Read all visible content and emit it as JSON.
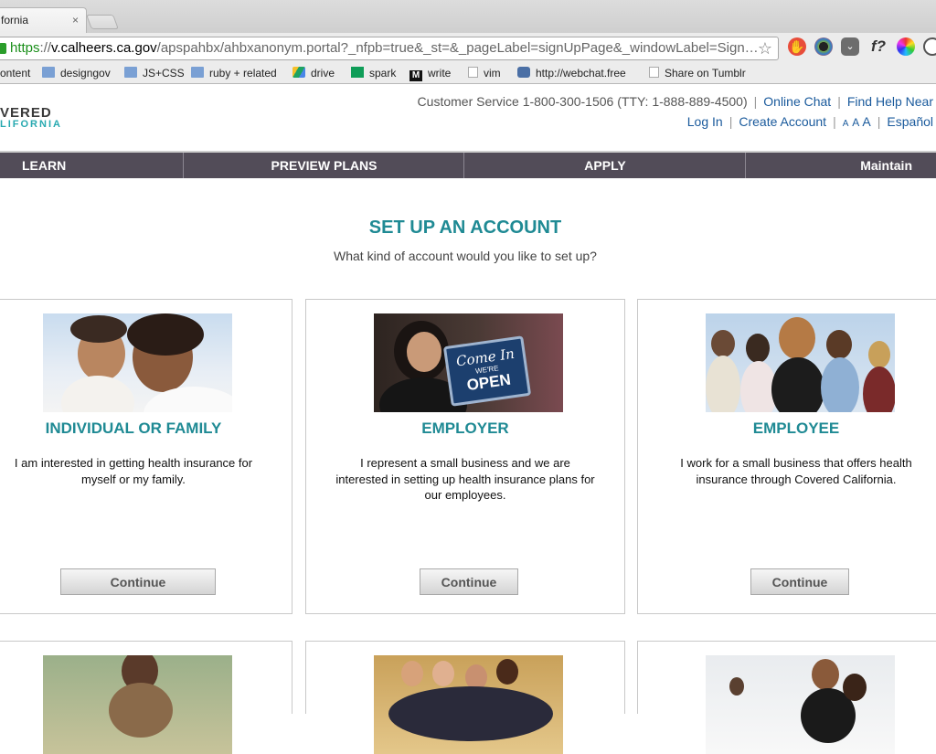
{
  "browser": {
    "tab_title": "fornia",
    "tab_close": "×",
    "url_scheme": "https",
    "url_sep": "://",
    "url_host": "v.calheers.ca.gov",
    "url_rest": "/apspahbx/ahbxanonym.portal?_nfpb=true&_st=&_pageLabel=signUpPage&_windowLabel=Sign…",
    "star_icon": "☆",
    "extensions": [
      "stop-hand-icon",
      "color-wheel-icon",
      "pocket-icon",
      "font-icon",
      "color-picker-icon",
      "extension-icon"
    ],
    "ext_labels": {
      "font": "f?"
    }
  },
  "bookmarks": [
    {
      "label": "ontent",
      "icon": "page-icon"
    },
    {
      "label": "designgov",
      "icon": "folder-icon"
    },
    {
      "label": "JS+CSS",
      "icon": "folder-icon"
    },
    {
      "label": "ruby + related",
      "icon": "folder-icon"
    },
    {
      "label": "drive",
      "icon": "drive-icon"
    },
    {
      "label": "spark",
      "icon": "sheets-icon"
    },
    {
      "label": "write",
      "icon": "medium-icon"
    },
    {
      "label": "vim",
      "icon": "page-icon"
    },
    {
      "label": "http://webchat.free",
      "icon": "globe-icon"
    },
    {
      "label": "Share on Tumblr",
      "icon": "page-icon"
    }
  ],
  "header": {
    "logo_top": "VERED",
    "logo_bottom": "LIFORNIA",
    "customer_service": "Customer Service 1-800-300-1506 (TTY: 1-888-889-4500)",
    "online_chat": "Online Chat",
    "find_help": "Find Help Near",
    "log_in": "Log In",
    "create_account": "Create Account",
    "text_size_small": "A",
    "text_size_medium": "A",
    "text_size_large": "A",
    "language": "Español",
    "separator": "|"
  },
  "nav": {
    "learn": "LEARN",
    "preview": "PREVIEW PLANS",
    "apply": "APPLY",
    "maintain": "Maintain"
  },
  "main": {
    "title": "SET UP AN ACCOUNT",
    "subtitle": "What kind of account would you like to set up?",
    "cards": [
      {
        "title": "INDIVIDUAL OR FAMILY",
        "description": "I am interested in getting health insurance for myself or my family.",
        "button": "Continue"
      },
      {
        "title": "EMPLOYER",
        "description": "I represent a small business and we are interested in setting up health insurance plans for our employees.",
        "button": "Continue",
        "sign_line1": "Come In",
        "sign_line2": "WE'RE",
        "sign_line3": "OPEN"
      },
      {
        "title": "EMPLOYEE",
        "description": "I work for a small business that offers health insurance through Covered California.",
        "button": "Continue"
      }
    ]
  },
  "colors": {
    "accent_teal": "#1f8a94",
    "nav_bg": "#524c58",
    "link_blue": "#1a5a9c"
  }
}
